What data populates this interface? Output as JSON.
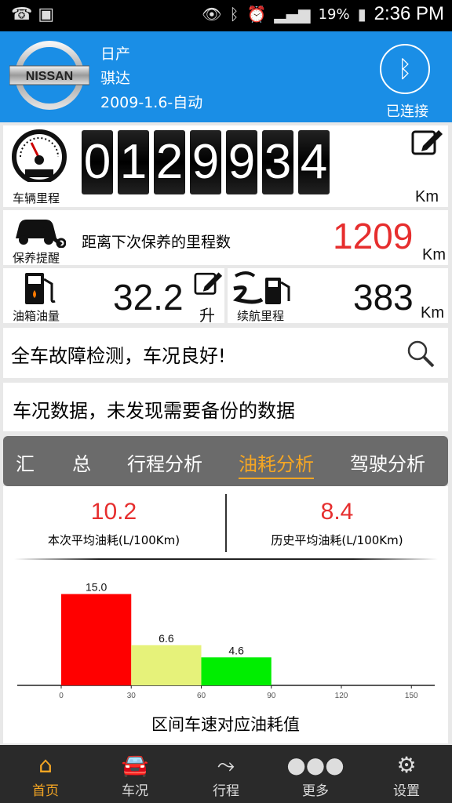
{
  "status": {
    "battery": "19%",
    "time": "2:36 PM"
  },
  "header": {
    "brand_logo_text": "NISSAN",
    "brand": "日产",
    "model": "骐达",
    "spec": "2009-1.6-自动",
    "bt_status": "已连接"
  },
  "odometer": {
    "label": "车辆里程",
    "digits": [
      "0",
      "1",
      "2",
      "9",
      "9",
      "3",
      "4"
    ],
    "unit": "Km"
  },
  "maintenance": {
    "label": "保养提醒",
    "text": "距离下次保养的里程数",
    "value": "1209",
    "unit": "Km"
  },
  "fuel": {
    "label": "油箱油量",
    "value": "32.2",
    "unit": "升"
  },
  "range": {
    "label": "续航里程",
    "value": "383",
    "unit": "Km"
  },
  "diagnosis": {
    "text": "全车故障检测，车况良好!"
  },
  "backup": {
    "text": "车况数据，未发现需要备份的数据"
  },
  "tabs": [
    "汇　　总",
    "行程分析",
    "油耗分析",
    "驾驶分析"
  ],
  "stats": {
    "current_value": "10.2",
    "current_label": "本次平均油耗(L/100Km)",
    "history_value": "8.4",
    "history_label": "历史平均油耗(L/100Km)"
  },
  "chart_data": {
    "type": "bar",
    "title": "区间车速对应油耗值",
    "x_ticks": [
      "0",
      "30",
      "60",
      "90",
      "120",
      "150"
    ],
    "bins": [
      {
        "from": 0,
        "to": 30,
        "value": 15.0,
        "label": "15.0",
        "color": "#ff0000"
      },
      {
        "from": 30,
        "to": 60,
        "value": 6.6,
        "label": "6.6",
        "color": "#e6f27a"
      },
      {
        "from": 60,
        "to": 90,
        "value": 4.6,
        "label": "4.6",
        "color": "#00ee00"
      }
    ],
    "xlim": [
      0,
      160
    ],
    "ylim": [
      0,
      17
    ]
  },
  "nav": [
    {
      "label": "首页",
      "icon": "home-icon"
    },
    {
      "label": "车况",
      "icon": "car-icon"
    },
    {
      "label": "行程",
      "icon": "route-icon"
    },
    {
      "label": "更多",
      "icon": "more-icon"
    },
    {
      "label": "设置",
      "icon": "gear-icon"
    }
  ]
}
